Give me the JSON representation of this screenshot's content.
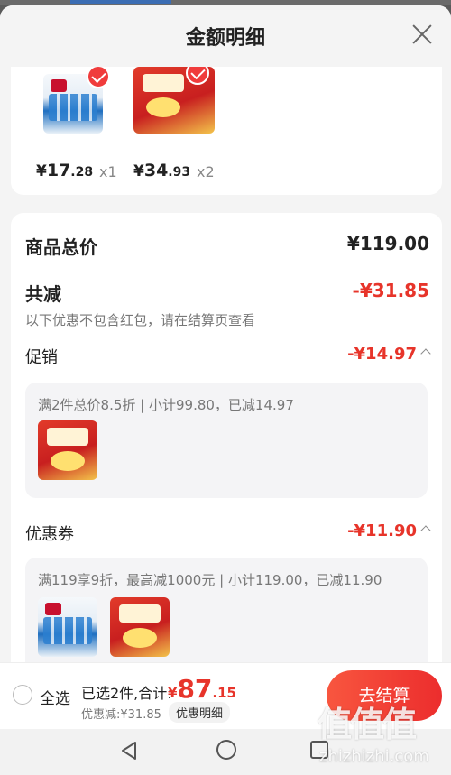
{
  "sheet": {
    "title": "金额明细"
  },
  "products": [
    {
      "name": "water",
      "price_yen": "¥",
      "price_int": "17",
      "price_dec": ".28",
      "qty": "x1"
    },
    {
      "name": "milk",
      "price_yen": "¥",
      "price_int": "34",
      "price_dec": ".93",
      "qty": "x2"
    }
  ],
  "summary": {
    "total_label": "商品总价",
    "total_value": "¥119.00",
    "reduction_label": "共减",
    "reduction_value": "-¥31.85",
    "note": "以下优惠不包含红包，请在结算页查看"
  },
  "promotion": {
    "label": "促销",
    "value": "-¥14.97",
    "desc": "满2件总价8.5折 | 小计99.80，已减14.97"
  },
  "coupon": {
    "label": "优惠券",
    "value": "-¥11.90",
    "desc": "满119享9折，最高减1000元 | 小计119.00，已减11.90"
  },
  "bottom_bar": {
    "select_all": "全选",
    "selected_summary": "已选2件,合计:",
    "total_yen": "¥",
    "total_int": "87",
    "total_dec": ".15",
    "discount": "优惠减:¥31.85",
    "details_button": "优惠明细",
    "checkout_button": "去结算"
  },
  "watermark": {
    "logo": "值值值",
    "text": "zhizhizhi.com"
  },
  "colors": {
    "accent": "#e7342a",
    "button": "#ec2d2d",
    "background": "#f4f4f4"
  },
  "icons": [
    "close-icon",
    "check-icon",
    "radio-icon",
    "back-icon",
    "home-icon",
    "recent-apps-icon",
    "chevron-up-icon"
  ]
}
